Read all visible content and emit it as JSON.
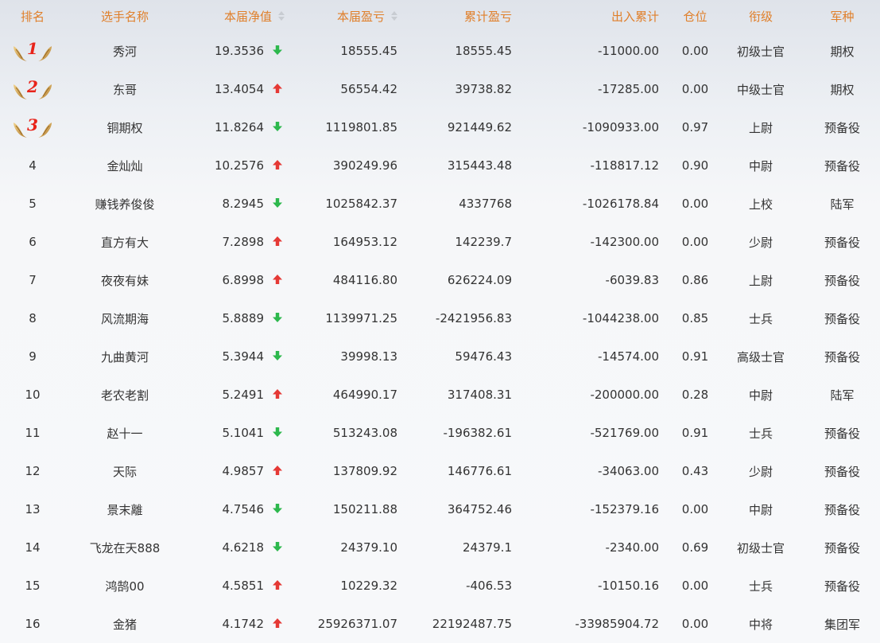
{
  "columns": {
    "rank": "排名",
    "name": "选手名称",
    "nav": "本届净值",
    "pnl": "本届盈亏",
    "cum_pnl": "累计盈亏",
    "flow": "出入累计",
    "position": "仓位",
    "rank_title": "衔级",
    "branch": "军种"
  },
  "colors": {
    "header_text": "#e07f2a",
    "up": "#e53935",
    "down": "#2db84d",
    "medal_number": "#e8231a"
  },
  "rows": [
    {
      "rank": "1",
      "medal": true,
      "name": "秀河",
      "nav": "19.3536",
      "trend": "down",
      "pnl": "18555.45",
      "cum": "18555.45",
      "flow": "-11000.00",
      "pos": "0.00",
      "title": "初级士官",
      "branch": "期权"
    },
    {
      "rank": "2",
      "medal": true,
      "name": "东哥",
      "nav": "13.4054",
      "trend": "up",
      "pnl": "56554.42",
      "cum": "39738.82",
      "flow": "-17285.00",
      "pos": "0.00",
      "title": "中级士官",
      "branch": "期权"
    },
    {
      "rank": "3",
      "medal": true,
      "name": "铜期权",
      "nav": "11.8264",
      "trend": "down",
      "pnl": "1119801.85",
      "cum": "921449.62",
      "flow": "-1090933.00",
      "pos": "0.97",
      "title": "上尉",
      "branch": "预备役"
    },
    {
      "rank": "4",
      "medal": false,
      "name": "金灿灿",
      "nav": "10.2576",
      "trend": "up",
      "pnl": "390249.96",
      "cum": "315443.48",
      "flow": "-118817.12",
      "pos": "0.90",
      "title": "中尉",
      "branch": "预备役"
    },
    {
      "rank": "5",
      "medal": false,
      "name": "赚钱养俊俊",
      "nav": "8.2945",
      "trend": "down",
      "pnl": "1025842.37",
      "cum": "4337768",
      "flow": "-1026178.84",
      "pos": "0.00",
      "title": "上校",
      "branch": "陆军"
    },
    {
      "rank": "6",
      "medal": false,
      "name": "直方有大",
      "nav": "7.2898",
      "trend": "up",
      "pnl": "164953.12",
      "cum": "142239.7",
      "flow": "-142300.00",
      "pos": "0.00",
      "title": "少尉",
      "branch": "预备役"
    },
    {
      "rank": "7",
      "medal": false,
      "name": "夜夜有妹",
      "nav": "6.8998",
      "trend": "up",
      "pnl": "484116.80",
      "cum": "626224.09",
      "flow": "-6039.83",
      "pos": "0.86",
      "title": "上尉",
      "branch": "预备役"
    },
    {
      "rank": "8",
      "medal": false,
      "name": "风流期海",
      "nav": "5.8889",
      "trend": "down",
      "pnl": "1139971.25",
      "cum": "-2421956.83",
      "flow": "-1044238.00",
      "pos": "0.85",
      "title": "士兵",
      "branch": "预备役"
    },
    {
      "rank": "9",
      "medal": false,
      "name": "九曲黄河",
      "nav": "5.3944",
      "trend": "down",
      "pnl": "39998.13",
      "cum": "59476.43",
      "flow": "-14574.00",
      "pos": "0.91",
      "title": "高级士官",
      "branch": "预备役"
    },
    {
      "rank": "10",
      "medal": false,
      "name": "老农老割",
      "nav": "5.2491",
      "trend": "up",
      "pnl": "464990.17",
      "cum": "317408.31",
      "flow": "-200000.00",
      "pos": "0.28",
      "title": "中尉",
      "branch": "陆军"
    },
    {
      "rank": "11",
      "medal": false,
      "name": "赵十一",
      "nav": "5.1041",
      "trend": "down",
      "pnl": "513243.08",
      "cum": "-196382.61",
      "flow": "-521769.00",
      "pos": "0.91",
      "title": "士兵",
      "branch": "预备役"
    },
    {
      "rank": "12",
      "medal": false,
      "name": "天际",
      "nav": "4.9857",
      "trend": "up",
      "pnl": "137809.92",
      "cum": "146776.61",
      "flow": "-34063.00",
      "pos": "0.43",
      "title": "少尉",
      "branch": "预备役"
    },
    {
      "rank": "13",
      "medal": false,
      "name": "景末離",
      "nav": "4.7546",
      "trend": "down",
      "pnl": "150211.88",
      "cum": "364752.46",
      "flow": "-152379.16",
      "pos": "0.00",
      "title": "中尉",
      "branch": "预备役"
    },
    {
      "rank": "14",
      "medal": false,
      "name": "飞龙在天888",
      "nav": "4.6218",
      "trend": "down",
      "pnl": "24379.10",
      "cum": "24379.1",
      "flow": "-2340.00",
      "pos": "0.69",
      "title": "初级士官",
      "branch": "预备役"
    },
    {
      "rank": "15",
      "medal": false,
      "name": "鸿鹄00",
      "nav": "4.5851",
      "trend": "up",
      "pnl": "10229.32",
      "cum": "-406.53",
      "flow": "-10150.16",
      "pos": "0.00",
      "title": "士兵",
      "branch": "预备役"
    },
    {
      "rank": "16",
      "medal": false,
      "name": "金猪",
      "nav": "4.1742",
      "trend": "up",
      "pnl": "25926371.07",
      "cum": "22192487.75",
      "flow": "-33985904.72",
      "pos": "0.00",
      "title": "中将",
      "branch": "集团军"
    }
  ]
}
